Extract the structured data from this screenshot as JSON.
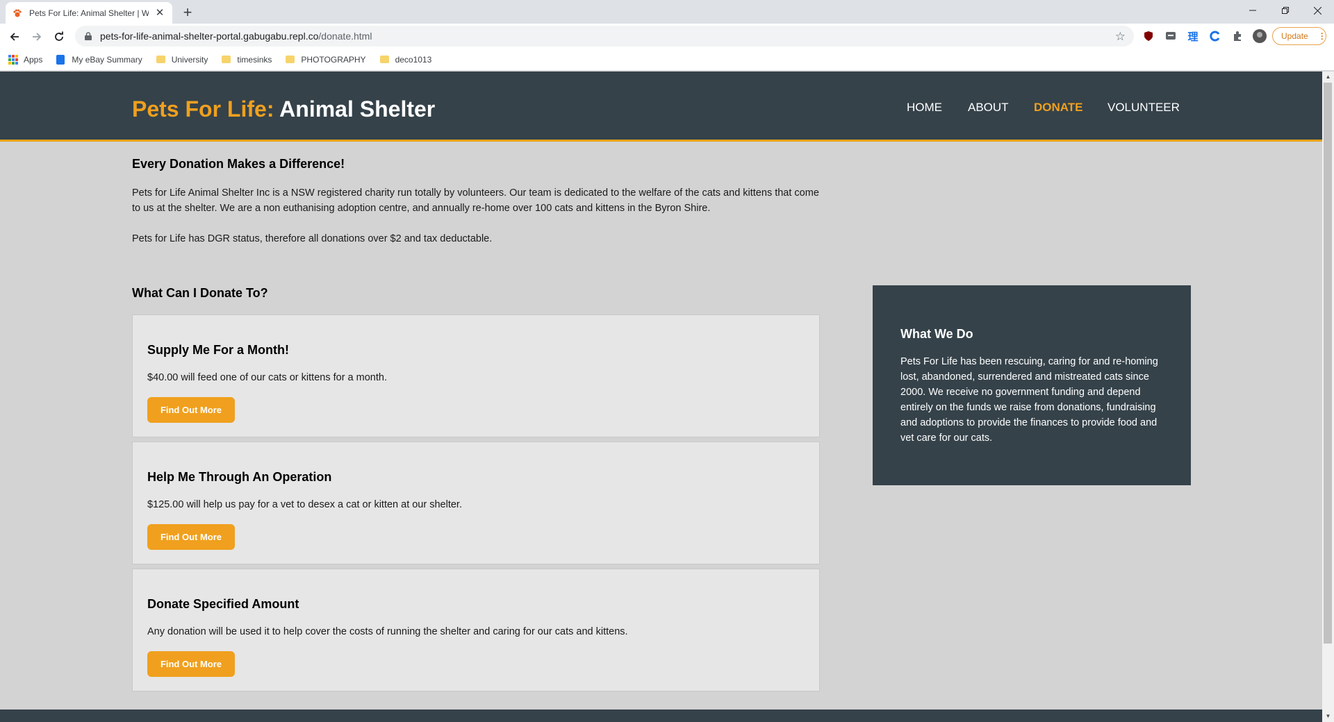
{
  "browser": {
    "tab_title": "Pets For Life: Animal Shelter | We",
    "url_host": "pets-for-life-animal-shelter-portal.gabugabu.repl.co",
    "url_path": "/donate.html",
    "update_label": "Update",
    "bookmarks": [
      {
        "label": "Apps",
        "icon": "apps-grid-icon"
      },
      {
        "label": "My eBay Summary",
        "icon": "shopping-bag-icon"
      },
      {
        "label": "University",
        "icon": "folder-icon"
      },
      {
        "label": "timesinks",
        "icon": "folder-icon"
      },
      {
        "label": "PHOTOGRAPHY",
        "icon": "folder-icon"
      },
      {
        "label": "deco1013",
        "icon": "folder-icon"
      }
    ]
  },
  "site": {
    "brand_highlight": "Pets For Life:",
    "brand_rest": " Animal Shelter",
    "nav": [
      {
        "label": "HOME",
        "active": false
      },
      {
        "label": "ABOUT",
        "active": false
      },
      {
        "label": "DONATE",
        "active": true
      },
      {
        "label": "VOLUNTEER",
        "active": false
      }
    ],
    "colors": {
      "header_bg": "#35424a",
      "accent": "#f0a01e",
      "page_bg": "#d3d3d3"
    }
  },
  "intro": {
    "title": "Every Donation Makes a Difference!",
    "p1": "Pets for Life Animal Shelter Inc is a NSW registered charity run totally by volunteers. Our team is dedicated to the welfare of the cats and kittens that come to us at the shelter. We are a non euthanising adoption centre, and annually re-home over 100 cats and kittens in the Byron Shire.",
    "p2": "Pets for Life has DGR status, therefore all donations over $2 and tax deductable."
  },
  "donate": {
    "title": "What Can I Donate To?",
    "cards": [
      {
        "title": "Supply Me For a Month!",
        "text": "$40.00 will feed one of our cats or kittens for a month.",
        "button": "Find Out More"
      },
      {
        "title": "Help Me Through An Operation",
        "text": "$125.00 will help us pay for a vet to desex a cat or kitten at our shelter.",
        "button": "Find Out More"
      },
      {
        "title": "Donate Specified Amount",
        "text": "Any donation will be used it to help cover the costs of running the shelter and caring for our cats and kittens.",
        "button": "Find Out More"
      }
    ]
  },
  "sidebar": {
    "title": "What We Do",
    "text": "Pets For Life has been rescuing, caring for and re-homing lost, abandoned, surrendered and mistreated cats since 2000. We receive no government funding and depend entirely on the funds we raise from donations, fundraising and adoptions to provide the finances to provide food and vet care for our cats."
  }
}
